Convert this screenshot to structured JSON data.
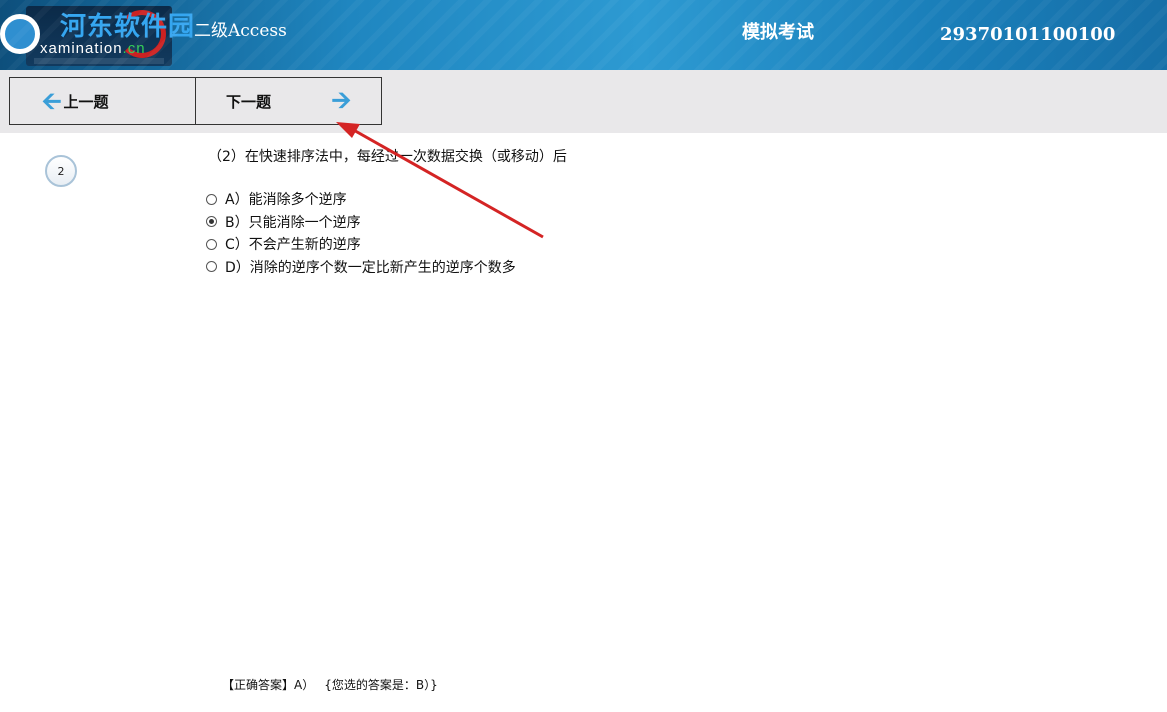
{
  "header": {
    "logo_text_main": "河东软件园",
    "logo_text_sub": "xamination",
    "logo_text_domain": ".cn",
    "app_title": "二级Access",
    "mode_title": "模拟考试",
    "exam_id": "29370101100100"
  },
  "toolbar": {
    "prev_label": "上一题",
    "next_label": "下一题"
  },
  "question": {
    "number": "2",
    "text": "（2）在快速排序法中，每经过一次数据交换（或移动）后",
    "options": [
      {
        "label": "A）能消除多个逆序",
        "selected": false
      },
      {
        "label": "B）只能消除一个逆序",
        "selected": true
      },
      {
        "label": "C）不会产生新的逆序",
        "selected": false
      },
      {
        "label": "D）消除的逆序个数一定比新产生的逆序个数多",
        "selected": false
      }
    ]
  },
  "answer": {
    "correct": "【正确答案】A）",
    "selected": "{您选的答案是：B）}"
  },
  "colors": {
    "header_bg": "#1f86c0",
    "toolbar_bg": "#e9e8ea",
    "arrow_icon": "#3a9ed8",
    "annotation_arrow": "#d42424"
  }
}
